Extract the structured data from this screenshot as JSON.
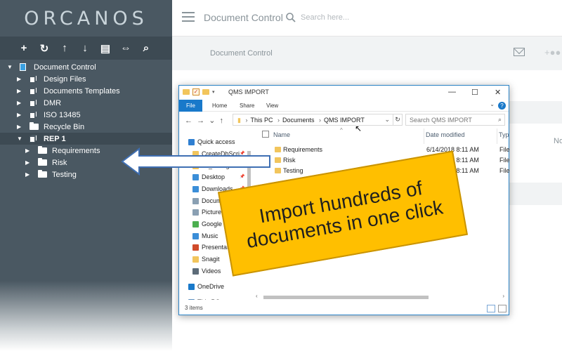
{
  "brand": {
    "logo_text": "ORCANOS"
  },
  "toolbar": {
    "icons": [
      "plus-icon",
      "refresh-icon",
      "arrow-up-icon",
      "arrow-down-icon",
      "document-edit-icon",
      "compare-icon",
      "search-icon"
    ],
    "glyphs": [
      "+",
      "↻",
      "↑",
      "↓",
      "▤",
      "⇔",
      "⌕"
    ]
  },
  "tree": {
    "items": [
      {
        "label": "Document Control",
        "level": 0,
        "expanded": true,
        "icon": "document-icon"
      },
      {
        "label": "Design Files",
        "level": 1,
        "expanded": false,
        "icon": "stack-icon"
      },
      {
        "label": "Documents Templates",
        "level": 1,
        "expanded": false,
        "icon": "stack-icon"
      },
      {
        "label": "DMR",
        "level": 1,
        "expanded": false,
        "icon": "stack-icon"
      },
      {
        "label": "ISO 13485",
        "level": 1,
        "expanded": false,
        "icon": "stack-icon"
      },
      {
        "label": "Recycle Bin",
        "level": 1,
        "expanded": false,
        "icon": "folder-icon"
      },
      {
        "label": "REP 1",
        "level": 1,
        "expanded": true,
        "icon": "stack-icon",
        "selected": true
      },
      {
        "label": "Requirements",
        "level": 2,
        "expanded": false,
        "icon": "folder-icon"
      },
      {
        "label": "Risk",
        "level": 2,
        "expanded": false,
        "icon": "folder-icon"
      },
      {
        "label": "Testing",
        "level": 2,
        "expanded": false,
        "icon": "folder-icon"
      }
    ]
  },
  "header": {
    "title": "Document Control",
    "search_placeholder": "Search here..."
  },
  "subheader": {
    "title": "Document Control"
  },
  "background": {
    "col_label": "No"
  },
  "explorer": {
    "window_title": "QMS IMPORT",
    "ribbon_tabs": [
      "File",
      "Home",
      "Share",
      "View"
    ],
    "address": [
      "This PC",
      "Documents",
      "QMS IMPORT"
    ],
    "search_placeholder": "Search QMS IMPORT",
    "nav_items": [
      {
        "label": "Quick access",
        "color": "#2f7fd1"
      },
      {
        "label": "CreateDbScri",
        "color": "#f2c55c",
        "pinned": true
      },
      {
        "label": "db_changes",
        "color": "#f2c55c",
        "pinned": true
      },
      {
        "label": "Desktop",
        "color": "#3b8ed8",
        "pinned": true
      },
      {
        "label": "Downloads",
        "color": "#3b8ed8",
        "pinned": true
      },
      {
        "label": "Documents",
        "color": "#8aa0b3",
        "pinned": true
      },
      {
        "label": "Pictures",
        "color": "#8aa0b3",
        "pinned": true
      },
      {
        "label": "Google",
        "color": "#4caf50"
      },
      {
        "label": "Music",
        "color": "#3b8ed8"
      },
      {
        "label": "Presentati",
        "color": "#d04b2a"
      },
      {
        "label": "Snagit",
        "color": "#f2c55c"
      },
      {
        "label": "Videos",
        "color": "#5c6b78"
      },
      {
        "label": "OneDrive",
        "color": "#1979ca"
      },
      {
        "label": "This PC",
        "color": "#5c8fc0"
      }
    ],
    "columns": [
      "Name",
      "Date modified",
      "Typ"
    ],
    "rows": [
      {
        "name": "Requirements",
        "date": "6/14/2018 8:11 AM",
        "type": "File"
      },
      {
        "name": "Risk",
        "date": "6/14/2018 8:11 AM",
        "type": "File"
      },
      {
        "name": "Testing",
        "date": "6/14/2018 8:11 AM",
        "type": "File"
      }
    ],
    "status": "3 items"
  },
  "callout": {
    "text": "Import hundreds of documents in one click",
    "color": "#ffbf00"
  },
  "accent": "#4a5862"
}
